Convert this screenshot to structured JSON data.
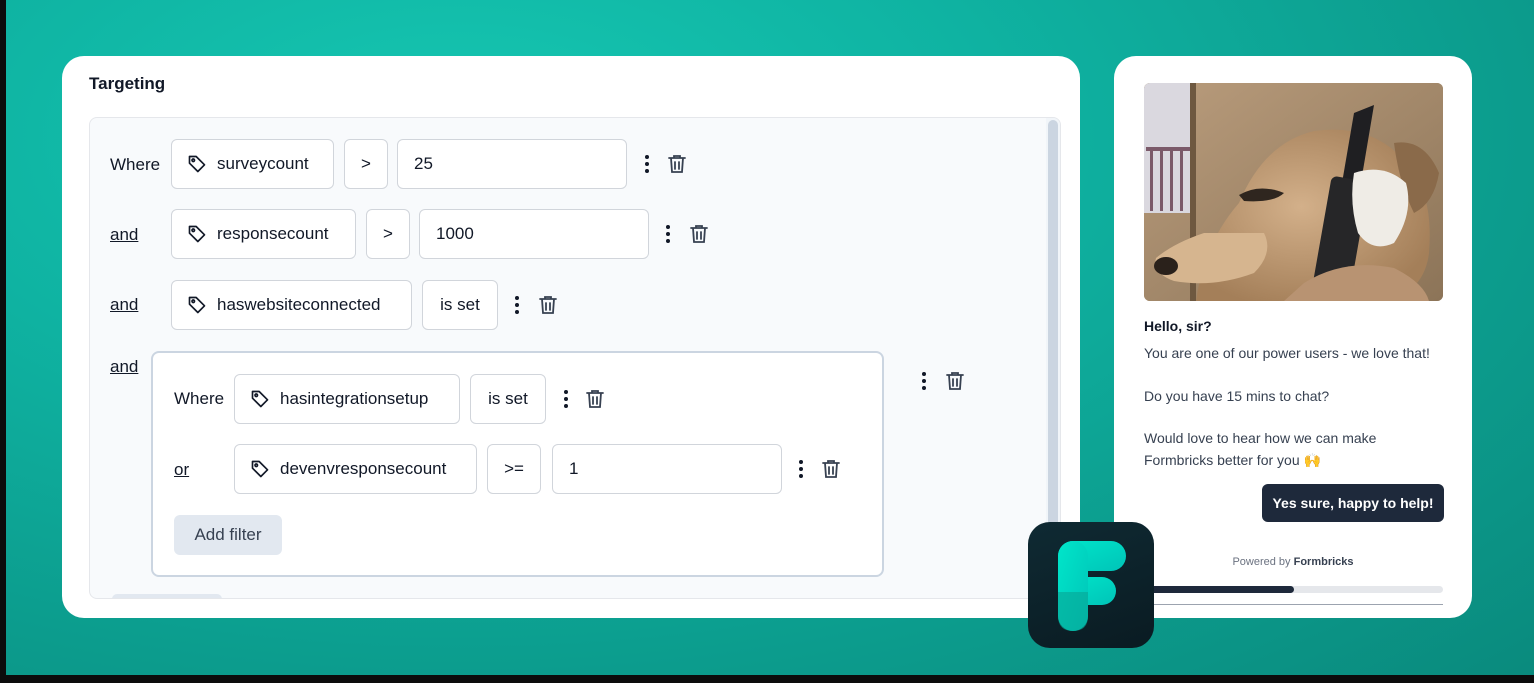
{
  "targeting": {
    "title": "Targeting",
    "rows": [
      {
        "connector": "Where",
        "attribute": "surveycount",
        "operator": ">",
        "value": "25"
      },
      {
        "connector": "and",
        "attribute": "responsecount",
        "operator": ">",
        "value": "1000"
      },
      {
        "connector": "and",
        "attribute": "haswebsiteconnected",
        "operator": "is set"
      }
    ],
    "group": {
      "connector": "and",
      "rows": [
        {
          "connector": "Where",
          "attribute": "hasintegrationsetup",
          "operator": "is set"
        },
        {
          "connector": "or",
          "attribute": "devenvresponsecount",
          "operator": ">=",
          "value": "1"
        }
      ],
      "add_filter_label": "Add filter"
    }
  },
  "survey": {
    "heading": "Hello, sir?",
    "line1": "You are one of our power users - we love that!",
    "line2": "Do you have 15 mins to chat?",
    "line3": "Would love to hear how we can make",
    "line4": "Formbricks better for you 🙌",
    "cta_label": "Yes sure, happy to help!",
    "powered_prefix": "Powered by",
    "powered_brand": "Formbricks",
    "progress": 0.5
  },
  "colors": {
    "background": "#10b5a3",
    "brand_teal": "#00e6ca",
    "dark_button": "#1e293b"
  },
  "icons": [
    "tag-icon",
    "kebab-menu-icon",
    "trash-icon",
    "formbricks-logo"
  ]
}
